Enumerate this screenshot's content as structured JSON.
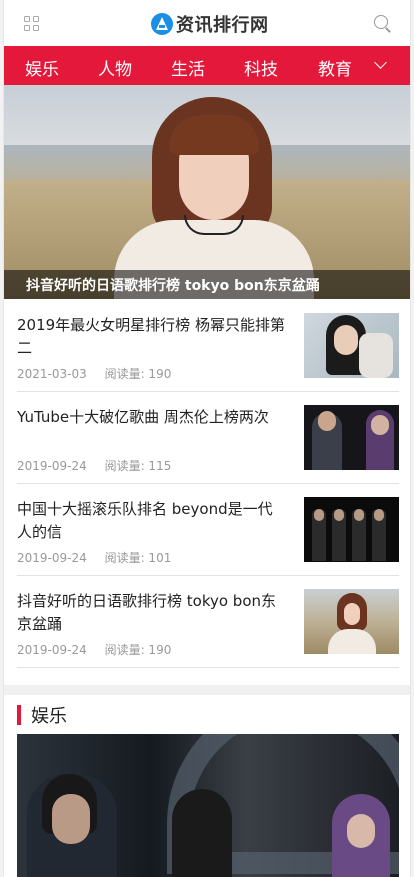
{
  "header": {
    "logo_text": "资讯排行网"
  },
  "nav": {
    "items": [
      "娱乐",
      "人物",
      "生活",
      "科技",
      "教育"
    ]
  },
  "hero": {
    "caption": "抖音好听的日语歌排行榜 tokyo bon东京盆踊"
  },
  "news": [
    {
      "title": "2019年最火女明星排行榜 杨幂只能排第二",
      "date": "2021-03-03",
      "reads": "阅读量: 190"
    },
    {
      "title": "YuTube十大破亿歌曲 周杰伦上榜两次",
      "date": "2019-09-24",
      "reads": "阅读量: 115"
    },
    {
      "title": "中国十大摇滚乐队排名 beyond是一代人的信",
      "date": "2019-09-24",
      "reads": "阅读量: 101"
    },
    {
      "title": "抖音好听的日语歌排行榜 tokyo bon东京盆踊",
      "date": "2019-09-24",
      "reads": "阅读量: 190"
    }
  ],
  "section": {
    "title": "娱乐"
  },
  "colors": {
    "accent": "#e3183a",
    "logo_blue": "#1a8fe3"
  }
}
